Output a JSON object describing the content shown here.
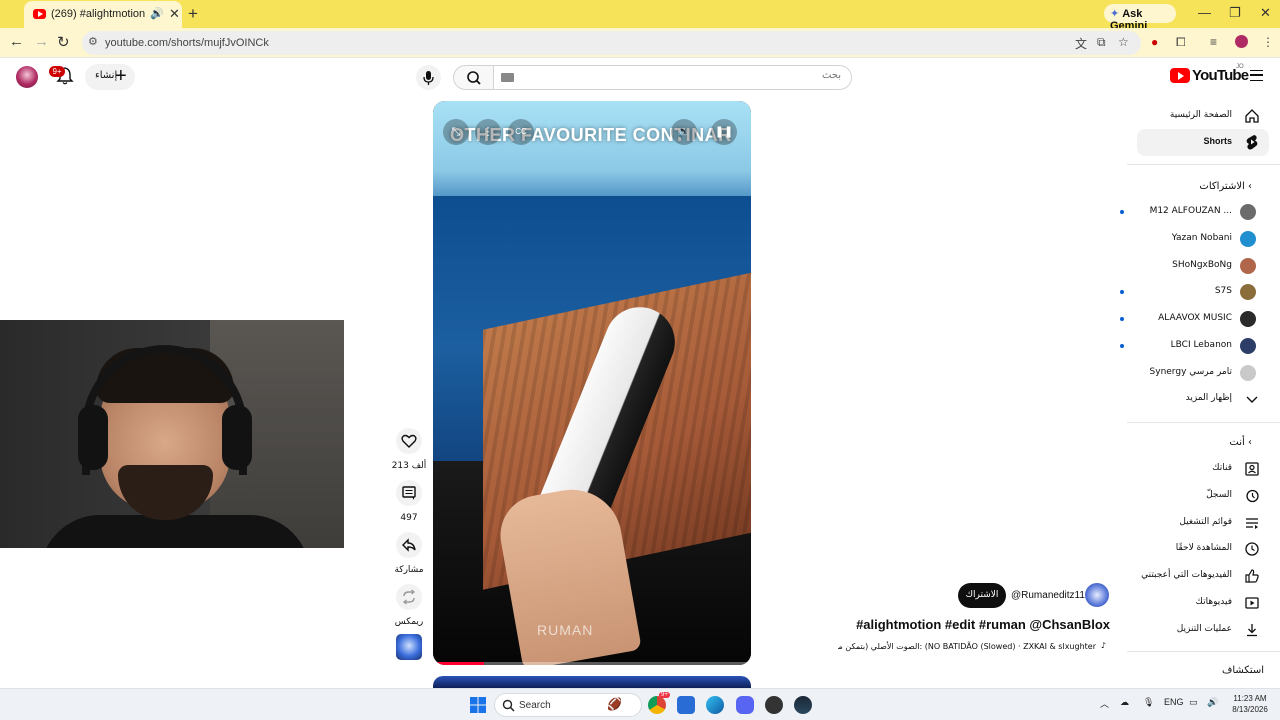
{
  "browser": {
    "tab_title": "(269) #alightmotion #edit #",
    "new_tab": "+",
    "ask_gemini": "Ask Gemini",
    "url": "youtube.com/shorts/mujfJvOINCk"
  },
  "youtube": {
    "logo_text": "YouTube",
    "logo_suffix": "JO",
    "search_placeholder": "بحث",
    "create_label": "إنشاء",
    "notification_count": "9+"
  },
  "video": {
    "overlay_text": "OTHER FAVOURITE CONTINAR",
    "watermark": "RUMAN",
    "progress_fraction": 0.16,
    "cc_label": "CC"
  },
  "actions": {
    "like_count": "213 ألف",
    "comment_count": "497",
    "share_label": "مشاركة",
    "remix_label": "ريمكس"
  },
  "channel": {
    "handle": "@Rumaneditz11",
    "subscribe_label": "الاشتراك",
    "title": "#alightmotion #edit #ruman @ChsanBlox",
    "audio": "الصوت الأصلي (بتمكن موسيقى من: (NO BATIDÃO (Slowed) · ZXKAI & slxughter"
  },
  "sidebar": {
    "home": "الصفحة الرئيسية",
    "shorts": "Shorts",
    "subscriptions_header": "الاشتراكات",
    "subscriptions": [
      {
        "name": "M12 ALFOUZAN ...",
        "avatar_color": "#6b6b6b",
        "new": true
      },
      {
        "name": "Yazan Nobani",
        "avatar_color": "#1f8fd0",
        "new": false
      },
      {
        "name": "SHoNgxBoNg",
        "avatar_color": "#b0664a",
        "new": false
      },
      {
        "name": "S7S",
        "avatar_color": "#8a6d3b",
        "new": true
      },
      {
        "name": "ALAAVOX MUSIC",
        "avatar_color": "#2b2b2b",
        "new": true
      },
      {
        "name": "LBCI Lebanon",
        "avatar_color": "#2c3e68",
        "new": true
      },
      {
        "name": "Synergy تامر مرسي",
        "avatar_color": "#c9c9c9",
        "new": false
      }
    ],
    "show_more": "إظهار المزيد",
    "you_header": "أنت",
    "you_items": [
      {
        "label": "قناتك",
        "icon": "channel-icon"
      },
      {
        "label": "السجلّ",
        "icon": "history-icon"
      },
      {
        "label": "قوائم التشغيل",
        "icon": "playlists-icon"
      },
      {
        "label": "المشاهدة لاحقًا",
        "icon": "watch-later-icon"
      },
      {
        "label": "الفيديوهات التي أعجبتني",
        "icon": "liked-icon"
      },
      {
        "label": "فيديوهاتك",
        "icon": "your-videos-icon"
      },
      {
        "label": "عمليات التنزيل",
        "icon": "downloads-icon"
      }
    ],
    "explore_header": "استكشاف"
  },
  "taskbar": {
    "search_label": "Search",
    "language": "ENG",
    "time": "11:23 AM",
    "date": "8/13/2026",
    "chrome_badge": "9+"
  }
}
